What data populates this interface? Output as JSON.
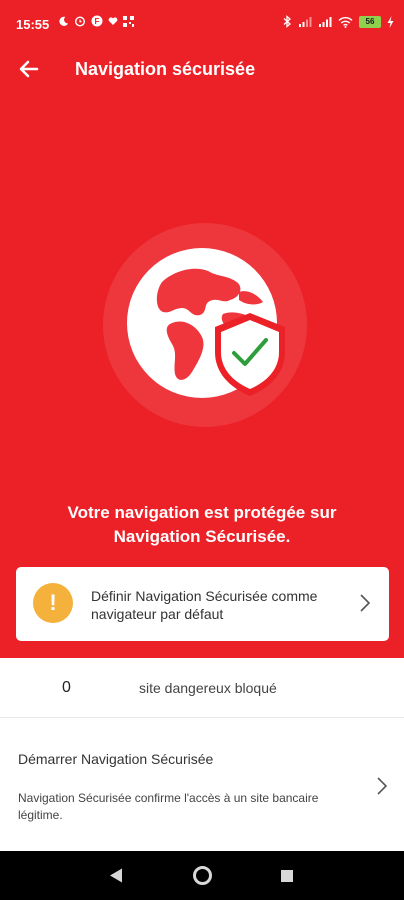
{
  "status_bar": {
    "time": "15:55",
    "battery": "56"
  },
  "app_bar": {
    "title": "Navigation sécurisée",
    "back_icon": "arrow-left-icon"
  },
  "hero": {
    "illustration": "globe-shield-check-icon",
    "message": "Votre navigation est protégée sur Navigation Sécurisée."
  },
  "default_card": {
    "icon": "warning-icon",
    "icon_text": "!",
    "text": "Définir Navigation Sécurisée comme navigateur par défaut",
    "chevron": "chevron-right-icon"
  },
  "stat": {
    "count": "0",
    "label": "site dangereux bloqué"
  },
  "start_section": {
    "title": "Démarrer Navigation Sécurisée",
    "description": "Navigation Sécurisée confirme l'accès à un site bancaire légitime.",
    "chevron": "chevron-right-icon"
  },
  "colors": {
    "brand_red": "#ec2027",
    "warning": "#f4b13c",
    "check_green": "#2e9e3c"
  }
}
